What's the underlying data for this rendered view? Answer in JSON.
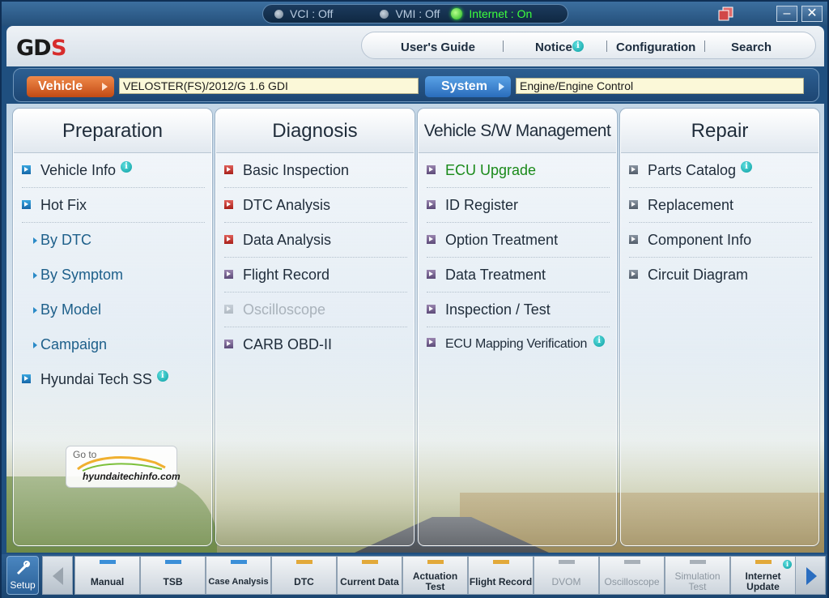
{
  "status": {
    "vci": "VCI : Off",
    "vmi": "VMI : Off",
    "internet": "Internet : On"
  },
  "window": {
    "minimize": "–",
    "close": "✕"
  },
  "logo": "GDS",
  "topnav": {
    "users_guide": "User's Guide",
    "notice": "Notice",
    "configuration": "Configuration",
    "search": "Search"
  },
  "selection": {
    "vehicle_label": "Vehicle",
    "vehicle_value": "VELOSTER(FS)/2012/G 1.6 GDI",
    "system_label": "System",
    "system_value": "Engine/Engine Control"
  },
  "panels": {
    "preparation": {
      "title": "Preparation",
      "items": [
        "Vehicle Info",
        "Hot Fix",
        "By DTC",
        "By Symptom",
        "By Model",
        "Campaign",
        "Hyundai Tech SS"
      ]
    },
    "diagnosis": {
      "title": "Diagnosis",
      "items": [
        "Basic Inspection",
        "DTC Analysis",
        "Data Analysis",
        "Flight Record",
        "Oscilloscope",
        "CARB OBD-II"
      ]
    },
    "sw_management": {
      "title": "Vehicle S/W Management",
      "items": [
        "ECU Upgrade",
        "ID Register",
        "Option Treatment",
        "Data Treatment",
        "Inspection / Test",
        "ECU Mapping Verification"
      ]
    },
    "repair": {
      "title": "Repair",
      "items": [
        "Parts Catalog",
        "Replacement",
        "Component Info",
        "Circuit Diagram"
      ]
    }
  },
  "goto": {
    "text": "Go to",
    "url": "hyundaitechinfo.com"
  },
  "toolbar": {
    "setup": "Setup",
    "buttons": [
      {
        "label": "Manual",
        "indicator": "#3b8fd8"
      },
      {
        "label": "TSB",
        "indicator": "#3b8fd8"
      },
      {
        "label": "Case Analysis",
        "indicator": "#3b8fd8"
      },
      {
        "label": "DTC",
        "indicator": "#e2a93a"
      },
      {
        "label": "Current Data",
        "indicator": "#e2a93a"
      },
      {
        "label": "Actuation Test",
        "indicator": "#e2a93a"
      },
      {
        "label": "Flight Record",
        "indicator": "#e2a93a"
      },
      {
        "label": "DVOM",
        "indicator": "#a8b0b8"
      },
      {
        "label": "Oscilloscope",
        "indicator": "#a8b0b8"
      },
      {
        "label": "Simulation Test",
        "indicator": "#a8b0b8"
      },
      {
        "label": "Internet Update",
        "indicator": "#e2a93a"
      }
    ]
  },
  "info_glyph": "i"
}
